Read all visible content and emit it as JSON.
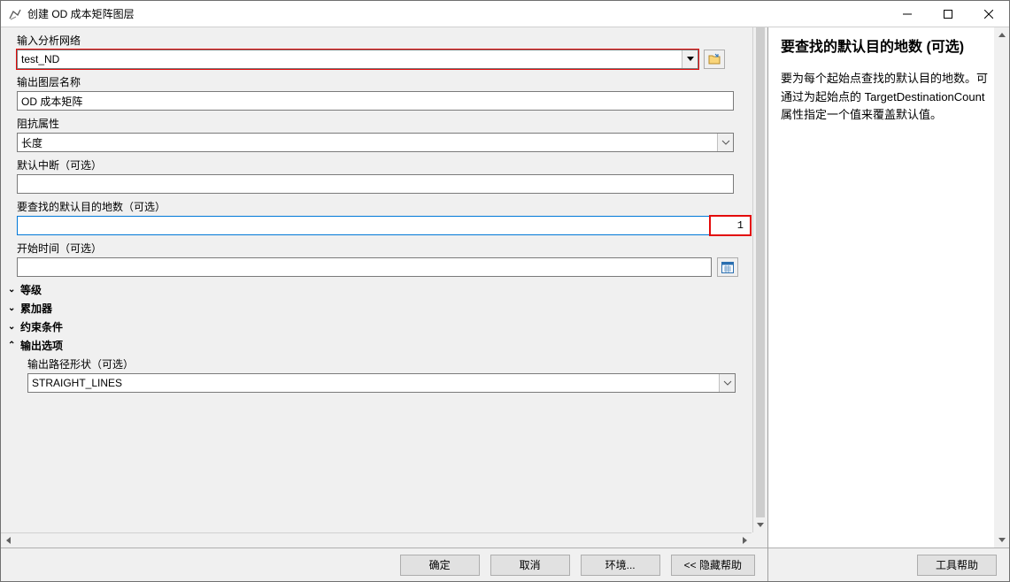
{
  "window": {
    "title": "创建 OD 成本矩阵图层"
  },
  "fields": {
    "network": {
      "label": "输入分析网络",
      "value": "test_ND"
    },
    "output_layer": {
      "label": "输出图层名称",
      "value": "OD 成本矩阵"
    },
    "impedance": {
      "label": "阻抗属性",
      "value": "长度"
    },
    "default_break": {
      "label": "默认中断（可选）",
      "value": ""
    },
    "target_dest": {
      "label": "要查找的默认目的地数（可选）",
      "value": "1"
    },
    "start_time": {
      "label": "开始时间（可选）",
      "value": ""
    },
    "output_shape": {
      "label": "输出路径形状（可选）",
      "value": "STRAIGHT_LINES"
    }
  },
  "sections": {
    "hierarchy": "等级",
    "accumulators": "累加器",
    "constraints": "约束条件",
    "output_options": "输出选项"
  },
  "help": {
    "title": "要查找的默认目的地数 (可选)",
    "body": "要为每个起始点查找的默认目的地数。可通过为起始点的 TargetDestinationCount 属性指定一个值来覆盖默认值。"
  },
  "buttons": {
    "ok": "确定",
    "cancel": "取消",
    "env": "环境...",
    "hide_help": "<< 隐藏帮助",
    "tool_help": "工具帮助"
  }
}
